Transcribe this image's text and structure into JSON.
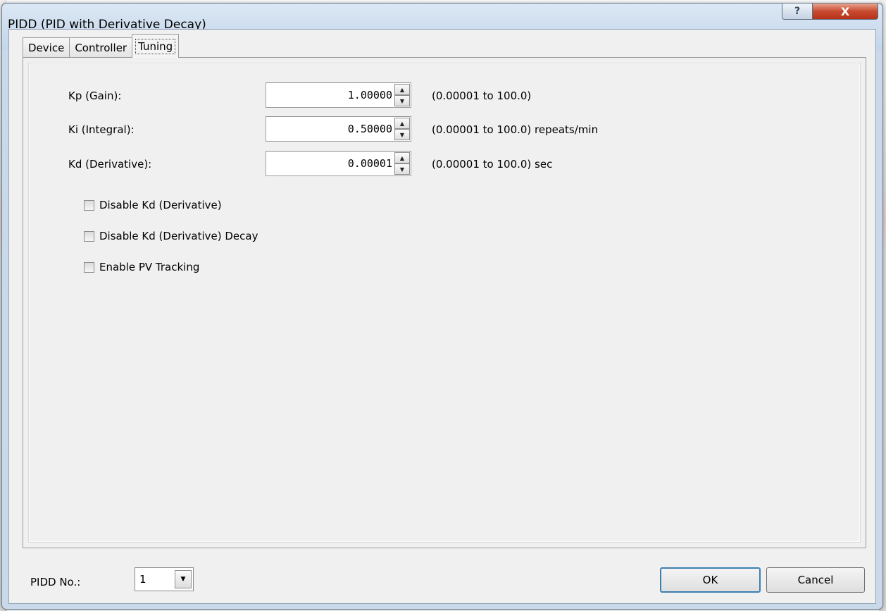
{
  "window": {
    "title": "PIDD (PID with Derivative Decay)",
    "help_glyph": "?",
    "close_glyph": "X"
  },
  "tabs": [
    {
      "label": "Device",
      "active": false
    },
    {
      "label": "Controller",
      "active": false
    },
    {
      "label": "Tuning",
      "active": true
    }
  ],
  "tuning": {
    "kp": {
      "label": "Kp (Gain):",
      "value": "1.00000",
      "range": "(0.00001 to 100.0)"
    },
    "ki": {
      "label": "Ki (Integral):",
      "value": "0.50000",
      "range": "(0.00001 to 100.0) repeats/min"
    },
    "kd": {
      "label": "Kd (Derivative):",
      "value": "0.00001",
      "range": "(0.00001 to 100.0) sec"
    }
  },
  "options": [
    {
      "label": "Disable Kd (Derivative)",
      "checked": false
    },
    {
      "label": "Disable Kd (Derivative) Decay",
      "checked": false
    },
    {
      "label": "Enable PV Tracking",
      "checked": false
    }
  ],
  "footer": {
    "pidd_label": "PIDD No.:",
    "pidd_value": "1",
    "ok_label": "OK",
    "cancel_label": "Cancel"
  },
  "icons": {
    "spin_up": "▲",
    "spin_down": "▼",
    "dropdown": "▼"
  },
  "colors": {
    "title_bar": "#c9d9ea",
    "client_bg": "#f0f0f0",
    "close_button": "#c74a30",
    "default_button_border": "#3c7fb1"
  }
}
